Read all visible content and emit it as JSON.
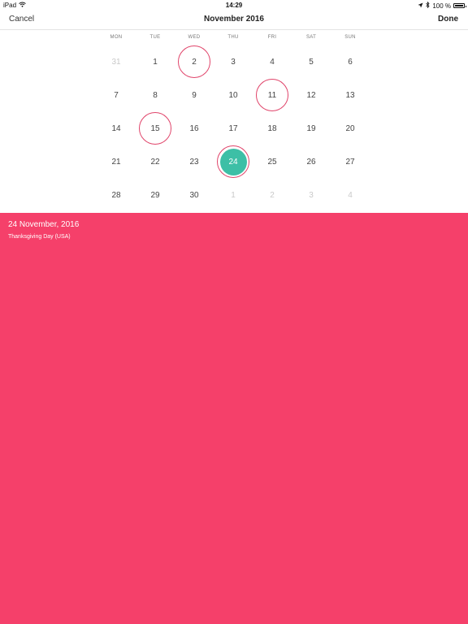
{
  "status_bar": {
    "device": "iPad",
    "time": "14:29",
    "battery": "100 %",
    "icons": [
      "wifi-icon",
      "location-arrow-icon",
      "bluetooth-icon",
      "battery-icon"
    ]
  },
  "nav": {
    "cancel_label": "Cancel",
    "title": "November 2016",
    "done_label": "Done"
  },
  "calendar": {
    "weekdays": [
      "MON",
      "TUE",
      "WED",
      "THU",
      "FRI",
      "SAT",
      "SUN"
    ],
    "weeks": [
      [
        {
          "d": "31",
          "muted": true
        },
        {
          "d": "1"
        },
        {
          "d": "2",
          "holiday": true
        },
        {
          "d": "3"
        },
        {
          "d": "4"
        },
        {
          "d": "5"
        },
        {
          "d": "6"
        }
      ],
      [
        {
          "d": "7"
        },
        {
          "d": "8"
        },
        {
          "d": "9"
        },
        {
          "d": "10"
        },
        {
          "d": "11",
          "holiday": true
        },
        {
          "d": "12"
        },
        {
          "d": "13"
        }
      ],
      [
        {
          "d": "14"
        },
        {
          "d": "15",
          "holiday": true
        },
        {
          "d": "16"
        },
        {
          "d": "17"
        },
        {
          "d": "18"
        },
        {
          "d": "19"
        },
        {
          "d": "20"
        }
      ],
      [
        {
          "d": "21"
        },
        {
          "d": "22"
        },
        {
          "d": "23"
        },
        {
          "d": "24",
          "selected": true
        },
        {
          "d": "25"
        },
        {
          "d": "26"
        },
        {
          "d": "27"
        }
      ],
      [
        {
          "d": "28"
        },
        {
          "d": "29"
        },
        {
          "d": "30"
        },
        {
          "d": "1",
          "muted": true
        },
        {
          "d": "2",
          "muted": true
        },
        {
          "d": "3",
          "muted": true
        },
        {
          "d": "4",
          "muted": true
        }
      ]
    ],
    "colors": {
      "holiday_ring": "#e0446a",
      "selected_fill": "#3dbfa6",
      "muted_text": "#c9c9c9"
    }
  },
  "detail": {
    "date": "24 November, 2016",
    "holiday": "Thanksgiving Day (USA)",
    "background": "#f5406a"
  }
}
